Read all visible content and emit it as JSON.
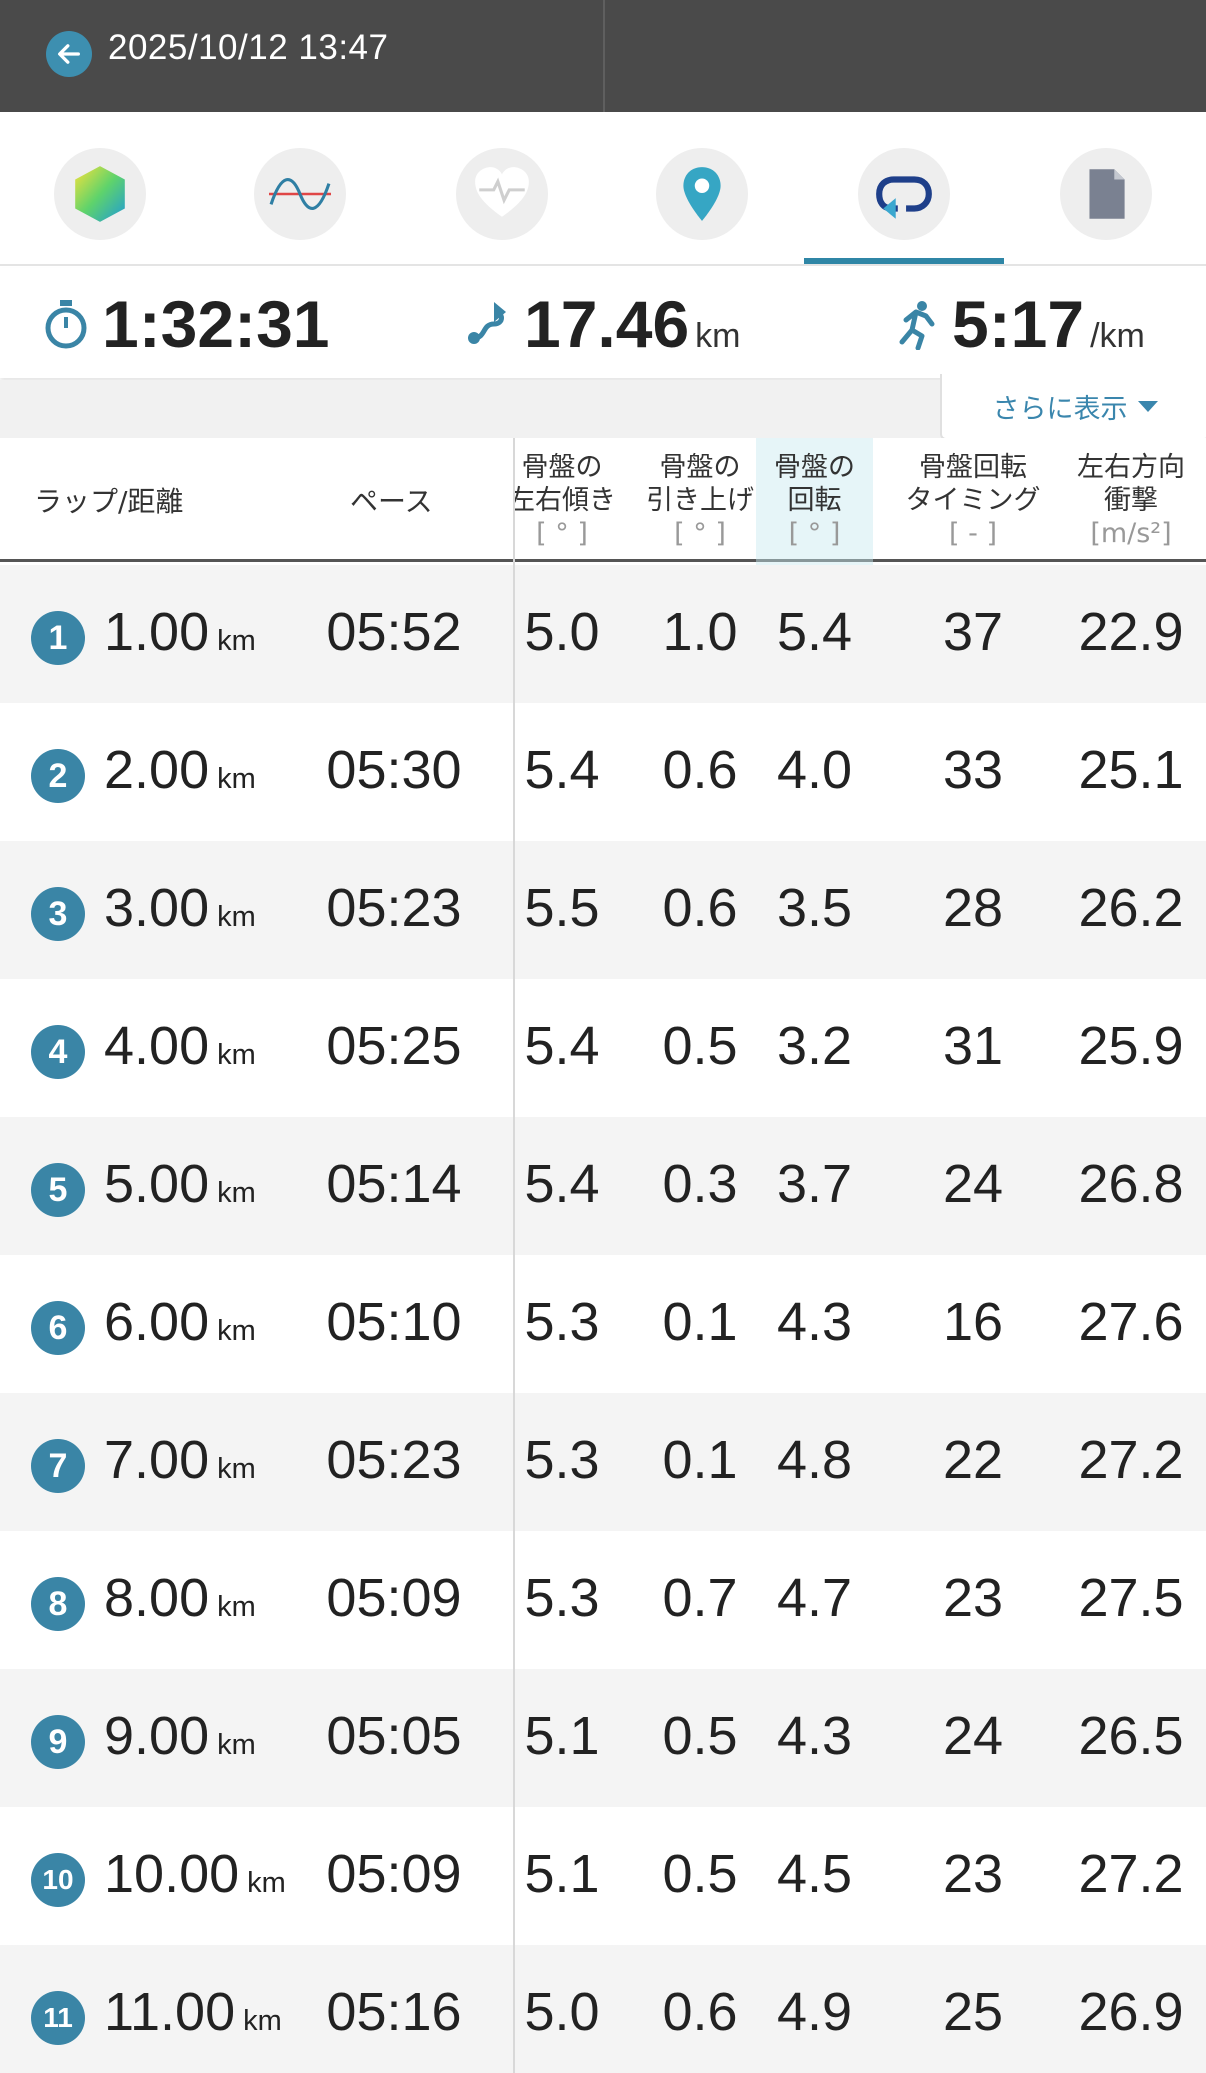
{
  "header": {
    "title": "2025/10/12 13:47"
  },
  "tabs": [
    {
      "name": "overview",
      "icon": "hexagon-gradient-icon"
    },
    {
      "name": "graph",
      "icon": "wave-graph-icon"
    },
    {
      "name": "heart-rate",
      "icon": "heart-rate-icon"
    },
    {
      "name": "map",
      "icon": "map-pin-icon"
    },
    {
      "name": "laps",
      "icon": "lap-loop-icon",
      "active": true
    },
    {
      "name": "memo",
      "icon": "document-icon"
    }
  ],
  "summary": {
    "time": "1:32:31",
    "distance": "17.46",
    "distance_unit": "km",
    "pace": "5:17",
    "pace_unit": "/km"
  },
  "more_label": "さらに表示",
  "table": {
    "col_lap": "ラップ/距離",
    "col_pace": "ペース",
    "col_tilt": {
      "line1": "骨盤の",
      "line2": "左右傾き",
      "unit": "[ ° ]"
    },
    "col_lift": {
      "line1": "骨盤の",
      "line2": "引き上げ",
      "unit": "[ ° ]"
    },
    "col_rot": {
      "line1": "骨盤の",
      "line2": "回転",
      "unit": "[ ° ]"
    },
    "col_timing": {
      "line1": "骨盤回転",
      "line2": "タイミング",
      "unit": "[ - ]"
    },
    "col_impact": {
      "line1": "左右方向",
      "line2": "衝撃",
      "unit": "[m/s²]"
    },
    "unit_km": "km",
    "rows": [
      {
        "lap": "1",
        "dist": "1.00",
        "pace": "05:52",
        "tilt": "5.0",
        "lift": "1.0",
        "rot": "5.4",
        "timing": "37",
        "impact": "22.9"
      },
      {
        "lap": "2",
        "dist": "2.00",
        "pace": "05:30",
        "tilt": "5.4",
        "lift": "0.6",
        "rot": "4.0",
        "timing": "33",
        "impact": "25.1"
      },
      {
        "lap": "3",
        "dist": "3.00",
        "pace": "05:23",
        "tilt": "5.5",
        "lift": "0.6",
        "rot": "3.5",
        "timing": "28",
        "impact": "26.2"
      },
      {
        "lap": "4",
        "dist": "4.00",
        "pace": "05:25",
        "tilt": "5.4",
        "lift": "0.5",
        "rot": "3.2",
        "timing": "31",
        "impact": "25.9"
      },
      {
        "lap": "5",
        "dist": "5.00",
        "pace": "05:14",
        "tilt": "5.4",
        "lift": "0.3",
        "rot": "3.7",
        "timing": "24",
        "impact": "26.8"
      },
      {
        "lap": "6",
        "dist": "6.00",
        "pace": "05:10",
        "tilt": "5.3",
        "lift": "0.1",
        "rot": "4.3",
        "timing": "16",
        "impact": "27.6"
      },
      {
        "lap": "7",
        "dist": "7.00",
        "pace": "05:23",
        "tilt": "5.3",
        "lift": "0.1",
        "rot": "4.8",
        "timing": "22",
        "impact": "27.2"
      },
      {
        "lap": "8",
        "dist": "8.00",
        "pace": "05:09",
        "tilt": "5.3",
        "lift": "0.7",
        "rot": "4.7",
        "timing": "23",
        "impact": "27.5"
      },
      {
        "lap": "9",
        "dist": "9.00",
        "pace": "05:05",
        "tilt": "5.1",
        "lift": "0.5",
        "rot": "4.3",
        "timing": "24",
        "impact": "26.5"
      },
      {
        "lap": "10",
        "dist": "10.00",
        "pace": "05:09",
        "tilt": "5.1",
        "lift": "0.5",
        "rot": "4.5",
        "timing": "23",
        "impact": "27.2"
      },
      {
        "lap": "11",
        "dist": "11.00",
        "pace": "05:16",
        "tilt": "5.0",
        "lift": "0.6",
        "rot": "4.9",
        "timing": "25",
        "impact": "26.9"
      }
    ]
  }
}
